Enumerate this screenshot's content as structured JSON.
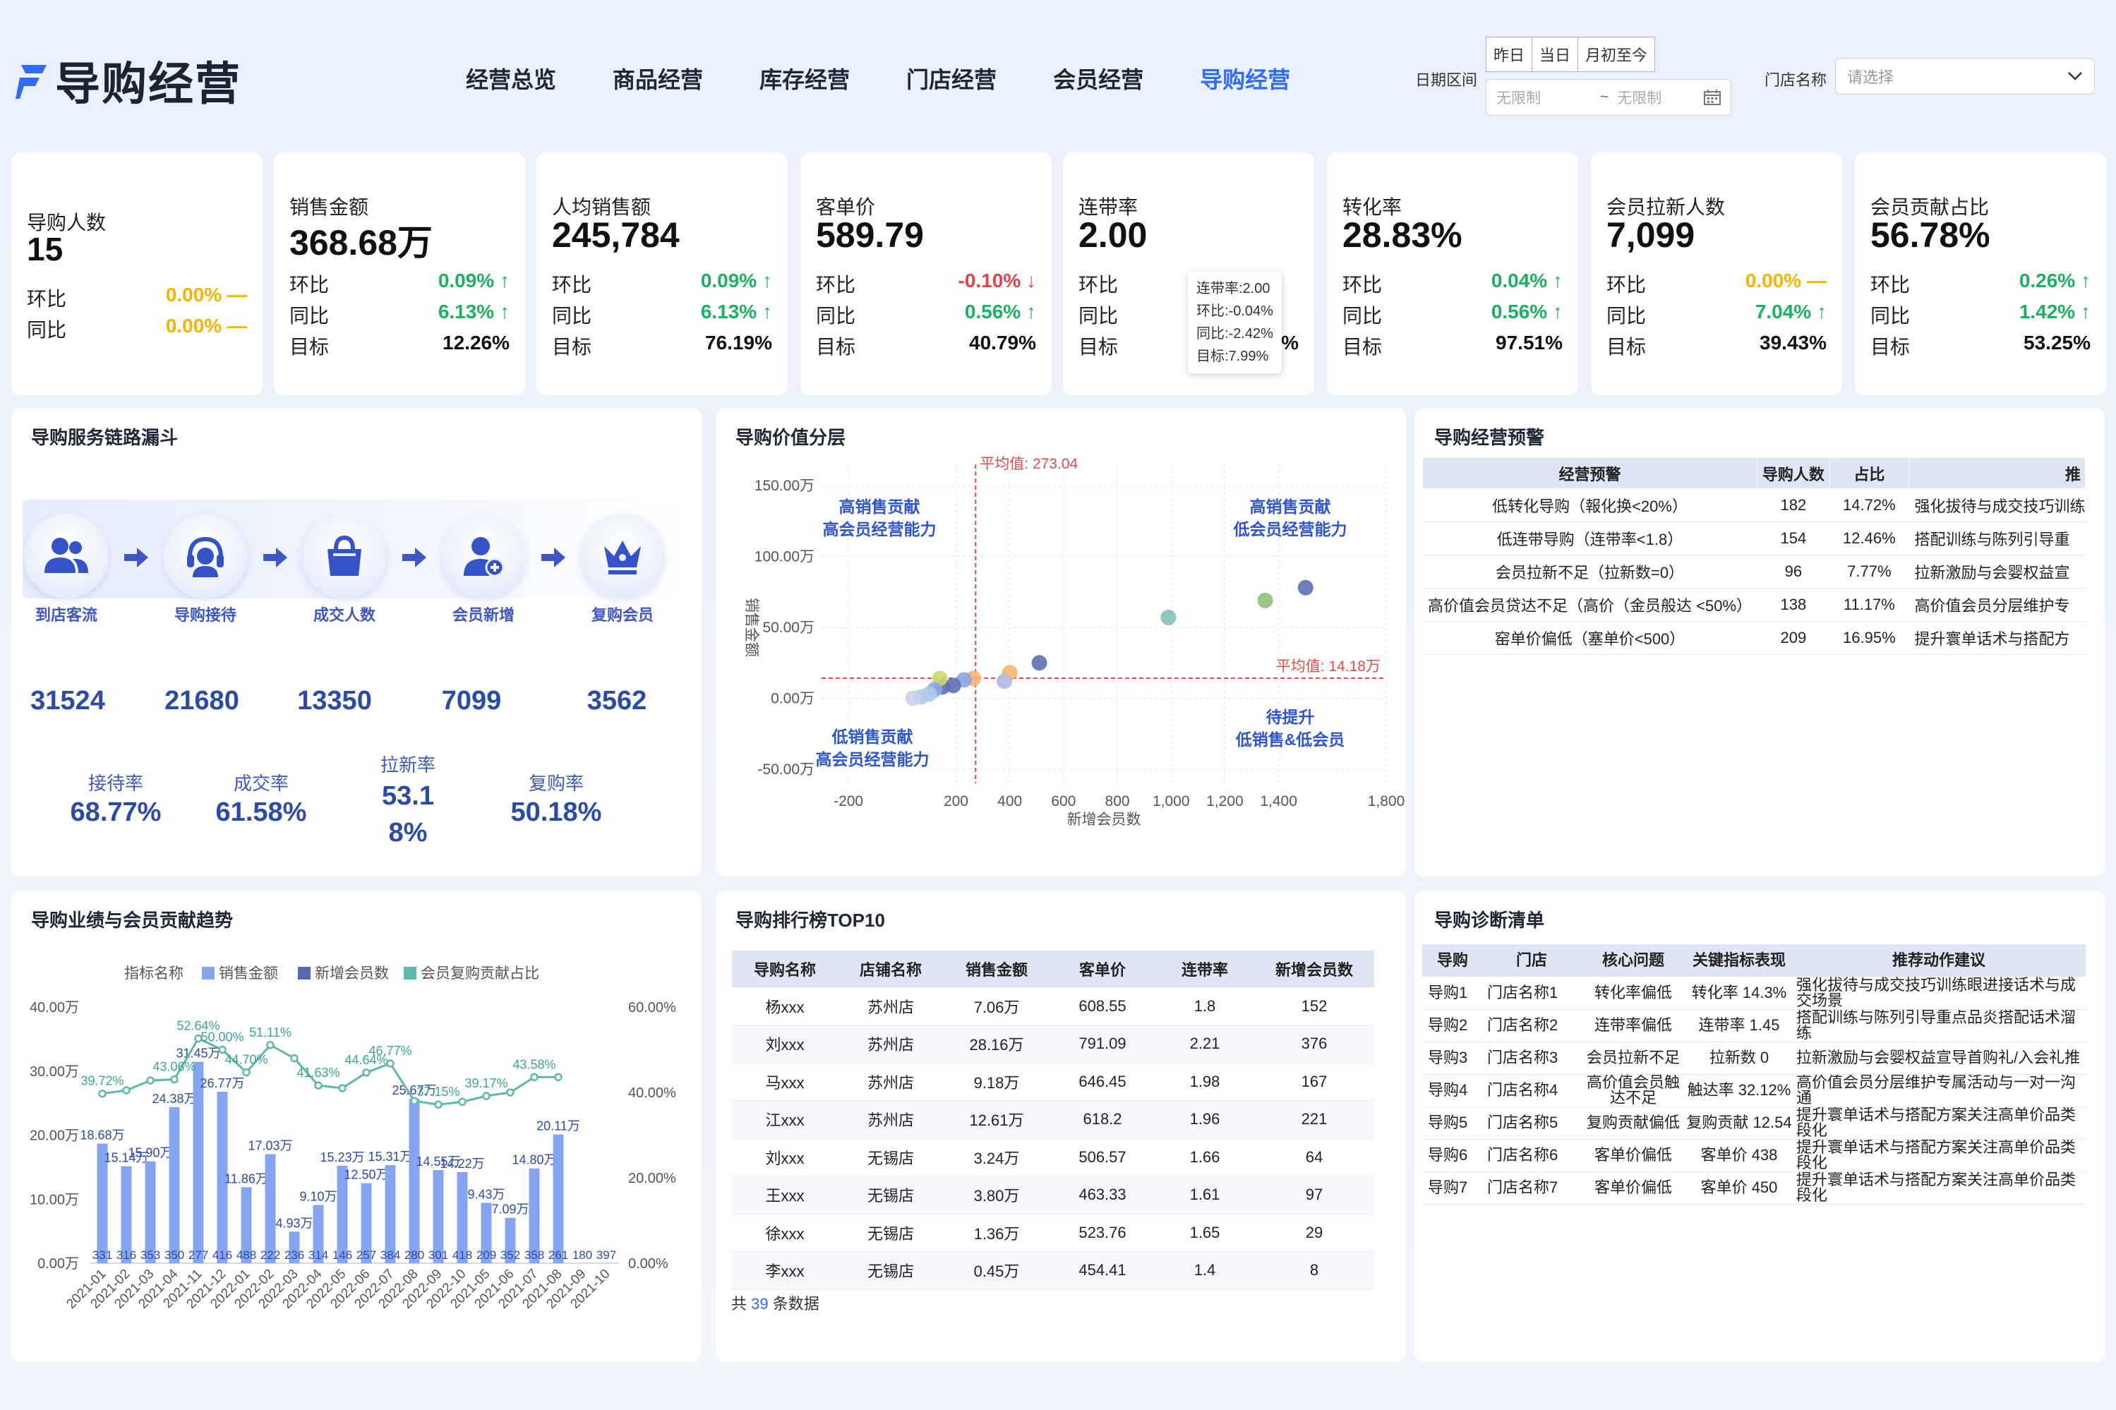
{
  "header": {
    "title": "导购经营",
    "nav": [
      "经营总览",
      "商品经营",
      "库存经营",
      "门店经营",
      "会员经营",
      "导购经营"
    ],
    "active_index": 5,
    "date_label": "日期区间",
    "quick": [
      "昨日",
      "当日",
      "月初至今"
    ],
    "date_start_placeholder": "无限制",
    "date_sep": "~",
    "date_end_placeholder": "无限制",
    "store_label": "门店名称",
    "store_placeholder": "请选择"
  },
  "kpis": [
    {
      "title": "导购人数",
      "value": "15",
      "rows": [
        {
          "label": "环比",
          "value": "0.00%",
          "trend": "flat"
        },
        {
          "label": "同比",
          "value": "0.00%",
          "trend": "flat"
        }
      ]
    },
    {
      "title": "销售金额",
      "value": "368.68万",
      "rows": [
        {
          "label": "环比",
          "value": "0.09%",
          "trend": "up"
        },
        {
          "label": "同比",
          "value": "6.13%",
          "trend": "up"
        },
        {
          "label": "目标",
          "value": "12.26%",
          "trend": "none"
        }
      ]
    },
    {
      "title": "人均销售额",
      "value": "245,784",
      "rows": [
        {
          "label": "环比",
          "value": "0.09%",
          "trend": "up"
        },
        {
          "label": "同比",
          "value": "6.13%",
          "trend": "up"
        },
        {
          "label": "目标",
          "value": "76.19%",
          "trend": "none"
        }
      ]
    },
    {
      "title": "客单价",
      "value": "589.79",
      "rows": [
        {
          "label": "环比",
          "value": "-0.10%",
          "trend": "down"
        },
        {
          "label": "同比",
          "value": "0.56%",
          "trend": "up"
        },
        {
          "label": "目标",
          "value": "40.79%",
          "trend": "none"
        }
      ]
    },
    {
      "title": "连带率",
      "value": "2.00",
      "rows": [
        {
          "label": "环比",
          "value": "",
          "trend": "none"
        },
        {
          "label": "同比",
          "value": "",
          "trend": "none"
        },
        {
          "label": "目标",
          "value": "%",
          "trend": "none"
        }
      ]
    },
    {
      "title": "转化率",
      "value": "28.83%",
      "rows": [
        {
          "label": "环比",
          "value": "0.04%",
          "trend": "up"
        },
        {
          "label": "同比",
          "value": "0.56%",
          "trend": "up"
        },
        {
          "label": "目标",
          "value": "97.51%",
          "trend": "none"
        }
      ]
    },
    {
      "title": "会员拉新人数",
      "value": "7,099",
      "rows": [
        {
          "label": "环比",
          "value": "0.00%",
          "trend": "flat"
        },
        {
          "label": "同比",
          "value": "7.04%",
          "trend": "up"
        },
        {
          "label": "目标",
          "value": "39.43%",
          "trend": "none"
        }
      ]
    },
    {
      "title": "会员贡献占比",
      "value": "56.78%",
      "rows": [
        {
          "label": "环比",
          "value": "0.26%",
          "trend": "up"
        },
        {
          "label": "同比",
          "value": "1.42%",
          "trend": "up"
        },
        {
          "label": "目标",
          "value": "53.25%",
          "trend": "none"
        }
      ]
    }
  ],
  "tooltip": [
    "连带率:2.00",
    "环比:-0.04%",
    "同比:-2.42%",
    "目标:7.99%"
  ],
  "funnel": {
    "title": "导购服务链路漏斗",
    "steps": [
      {
        "label": "到店客流",
        "value": "31524",
        "icon": "people-icon"
      },
      {
        "label": "导购接待",
        "value": "21680",
        "icon": "headset-icon"
      },
      {
        "label": "成交人数",
        "value": "13350",
        "icon": "bag-icon"
      },
      {
        "label": "会员新增",
        "value": "7099",
        "icon": "user-add-icon"
      },
      {
        "label": "复购会员",
        "value": "3562",
        "icon": "crown-icon"
      }
    ],
    "rates": [
      {
        "label": "接待率",
        "value": "68.77%"
      },
      {
        "label": "成交率",
        "value": "61.58%"
      },
      {
        "label": "拉新率",
        "value": "53.1\n8%"
      },
      {
        "label": "复购率",
        "value": "50.18%"
      }
    ]
  },
  "value_layer": {
    "title": "导购价值分层"
  },
  "warning": {
    "title": "导购经营预警",
    "columns": [
      "经营预警",
      "导购人数",
      "占比",
      "推"
    ],
    "rows": [
      [
        "低转化导购（報化换<20%）",
        "182",
        "14.72%",
        "强化拔待与成交技巧训练"
      ],
      [
        "低连带导购（连带率<1.8）",
        "154",
        "12.46%",
        "搭配训练与陈列引导重"
      ],
      [
        "会员拉新不足（拉新数=0）",
        "96",
        "7.77%",
        "拉新激励与会婴权益宣"
      ],
      [
        "高价值会员贷达不足（高价（金员般达 <50%）",
        "138",
        "11.17%",
        "高价值会员分层维护专"
      ],
      [
        "窑单价偏低（塞单价<500）",
        "209",
        "16.95%",
        "提升寰单话术与搭配方"
      ]
    ]
  },
  "trend": {
    "title": "导购业绩与会员贡献趋势"
  },
  "ranking": {
    "title": "导购排行榜TOP10",
    "columns": [
      "导购名称",
      "店铺名称",
      "销售金额",
      "客单价",
      "连带率",
      "新增会员数"
    ],
    "rows": [
      [
        "杨xxx",
        "苏州店",
        "7.06万",
        "608.55",
        "1.8",
        "152"
      ],
      [
        "刘xxx",
        "苏州店",
        "28.16万",
        "791.09",
        "2.21",
        "376"
      ],
      [
        "马xxx",
        "苏州店",
        "9.18万",
        "646.45",
        "1.98",
        "167"
      ],
      [
        "江xxx",
        "苏州店",
        "12.61万",
        "618.2",
        "1.96",
        "221"
      ],
      [
        "刘xxx",
        "无锡店",
        "3.24万",
        "506.57",
        "1.66",
        "64"
      ],
      [
        "王xxx",
        "无锡店",
        "3.80万",
        "463.33",
        "1.61",
        "97"
      ],
      [
        "徐xxx",
        "无锡店",
        "1.36万",
        "523.76",
        "1.65",
        "29"
      ],
      [
        "李xxx",
        "无锡店",
        "0.45万",
        "454.41",
        "1.4",
        "8"
      ]
    ],
    "footer_prefix": "共",
    "footer_count": "39",
    "footer_suffix": "条数据"
  },
  "diagnosis": {
    "title": "导购诊断清单",
    "columns": [
      "导购",
      "门店",
      "核心问题",
      "关键指标表现",
      "推荐动作建议"
    ],
    "rows": [
      [
        "导购1",
        "门店名称1",
        "转化率偏低",
        "转化率 14.3%",
        "强化拔待与成交技巧训练眼进接话术与成交场景"
      ],
      [
        "导购2",
        "门店名称2",
        "连带率偏低",
        "连带率 1.45",
        "搭配训练与陈列引导重点品炎搭配话术溜练"
      ],
      [
        "导购3",
        "门店名称3",
        "会员拉新不足",
        "拉新数 0",
        "拉新激励与会婴权益宣导首购礼/入会礼推"
      ],
      [
        "导购4",
        "门店名称4",
        "高价值会员触达不足",
        "触达率 32.12%",
        "高价值会员分层维护专属活动与一对一沟通"
      ],
      [
        "导购5",
        "门店名称5",
        "复购贡献偏低",
        "复购贡献 12.54",
        "提升寰单话术与搭配方案关注高单价品类段化"
      ],
      [
        "导购6",
        "门店名称6",
        "客单价偏低",
        "客单价 438",
        "提升寰单话术与搭配方案关注高单价品类段化"
      ],
      [
        "导购7",
        "门店名称7",
        "客单价偏低",
        "客单价 450",
        "提升寰单话术与搭配方案关注高单价品类段化"
      ]
    ]
  },
  "chart_data": [
    {
      "type": "scatter",
      "title": "导购价值分层",
      "xlabel": "新增会员数",
      "ylabel": "销售金额",
      "xlim": [
        -300,
        1800
      ],
      "ylim": [
        -60,
        160
      ],
      "x_ticks": [
        "-200",
        "200",
        "400",
        "600",
        "800",
        "1,000",
        "1,200",
        "1,400",
        "1,800"
      ],
      "x_tick_values": [
        -200,
        200,
        400,
        600,
        800,
        1000,
        1200,
        1400,
        1800
      ],
      "y_ticks": [
        "-50.00万",
        "0.00万",
        "50.00万",
        "100.00万",
        "150.00万"
      ],
      "y_tick_values": [
        -50,
        0,
        50,
        100,
        150
      ],
      "avg_x": 273.04,
      "avg_x_label": "平均值: 273.04",
      "avg_y": 14.18,
      "avg_y_label": "平均值: 14.18万",
      "quadrants": [
        {
          "lines": [
            "高销售贡献",
            "高会员经营能力"
          ],
          "pos": "top-left"
        },
        {
          "lines": [
            "高销售贡献",
            "低会员经营能力"
          ],
          "pos": "top-right"
        },
        {
          "lines": [
            "低销售贡献",
            "高会员经营能力"
          ],
          "pos": "bottom-left"
        },
        {
          "lines": [
            "待提升",
            "低销售&低会员"
          ],
          "pos": "bottom-right"
        }
      ],
      "points": [
        {
          "x": 1500,
          "y": 78,
          "color": "#5b6fb3"
        },
        {
          "x": 1350,
          "y": 69,
          "color": "#8ebf7a"
        },
        {
          "x": 990,
          "y": 57,
          "color": "#7fc0b5"
        },
        {
          "x": 510,
          "y": 25,
          "color": "#5b6fb3"
        },
        {
          "x": 400,
          "y": 18,
          "color": "#f5b26b"
        },
        {
          "x": 380,
          "y": 12,
          "color": "#aebcdf"
        },
        {
          "x": 265,
          "y": 14,
          "color": "#f5b26b"
        },
        {
          "x": 230,
          "y": 13,
          "color": "#8aa6e6"
        },
        {
          "x": 190,
          "y": 9,
          "color": "#5b6fb3"
        },
        {
          "x": 150,
          "y": 8,
          "color": "#5b6fb3"
        },
        {
          "x": 140,
          "y": 14,
          "color": "#c9d96d"
        },
        {
          "x": 120,
          "y": 6,
          "color": "#8aa6e6"
        },
        {
          "x": 100,
          "y": 3,
          "color": "#aec6e8"
        },
        {
          "x": 70,
          "y": 1,
          "color": "#b8c7e6"
        },
        {
          "x": 40,
          "y": 0,
          "color": "#c7d3ec"
        }
      ]
    },
    {
      "type": "bar",
      "title": "导购业绩与会员贡献趋势",
      "legend_title": "指标名称",
      "categories": [
        "2021-01",
        "2021-02",
        "2021-03",
        "2021-04",
        "2021-11",
        "2021-12",
        "2022-01",
        "2022-02",
        "2022-03",
        "2022-04",
        "2022-05",
        "2022-06",
        "2022-07",
        "2022-08",
        "2022-09",
        "2022-10",
        "2021-05",
        "2021-06",
        "2021-07",
        "2021-08",
        "2021-09",
        "2021-10"
      ],
      "series": [
        {
          "name": "销售金额",
          "type": "bar",
          "axis": "left",
          "color": "#86a5f0",
          "values": [
            18.68,
            15.14,
            15.9,
            24.38,
            31.45,
            26.77,
            11.86,
            17.03,
            4.93,
            9.1,
            15.23,
            12.5,
            15.31,
            25.67,
            14.55,
            14.22,
            9.43,
            7.09,
            14.8,
            20.11,
            null,
            null
          ],
          "labels": [
            "18.68万",
            "15.14万",
            "15.90万",
            "24.38万",
            "31.45万",
            "26.77万",
            "11.86万",
            "17.03万",
            "4.93万",
            "9.10万",
            "15.23万",
            "12.50万",
            "15.31万",
            "25.67万",
            "14.55万",
            "14.22万",
            "9.43万",
            "7.09万",
            "14.80万",
            "20.11万"
          ]
        },
        {
          "name": "新增会员数",
          "type": "bar",
          "axis": "none",
          "color": "#5369b3",
          "values": [
            331,
            316,
            353,
            350,
            277,
            416,
            488,
            222,
            236,
            314,
            146,
            257,
            384,
            280,
            301,
            418,
            209,
            352,
            358,
            261,
            180,
            397
          ]
        },
        {
          "name": "会员复购贡献占比",
          "type": "line",
          "axis": "right",
          "color": "#5cb8ad",
          "values": [
            39.72,
            40.5,
            42.8,
            43.06,
            52.64,
            50.0,
            44.7,
            51.11,
            48.0,
            41.63,
            41.0,
            44.64,
            46.77,
            38.0,
            37.15,
            37.8,
            39.17,
            40.0,
            43.58,
            43.58
          ],
          "labels": [
            "39.72%",
            "",
            "",
            "43.06%",
            "52.64%",
            "50.00%",
            "44.70%",
            "51.11%",
            "",
            "41.63%",
            "",
            "44.64%",
            "46.77%",
            "",
            "37.15%",
            "",
            "39.17%",
            "",
            "43.58%",
            ""
          ]
        }
      ],
      "left_ticks": [
        "0.00万",
        "10.00万",
        "20.00万",
        "30.00万",
        "40.00万"
      ],
      "left_tick_values": [
        0,
        10,
        20,
        30,
        40
      ],
      "right_ticks": [
        "0.00%",
        "20.00%",
        "40.00%",
        "60.00%"
      ],
      "right_tick_values": [
        0,
        20,
        40,
        60
      ],
      "ylim_left": [
        0,
        40
      ],
      "ylim_right": [
        0,
        60
      ]
    }
  ],
  "colors": {
    "accent": "#2f6bff",
    "up": "#1bb15e",
    "down": "#e5414b",
    "flat": "#f5b400",
    "funnel": "#3f57c4"
  }
}
